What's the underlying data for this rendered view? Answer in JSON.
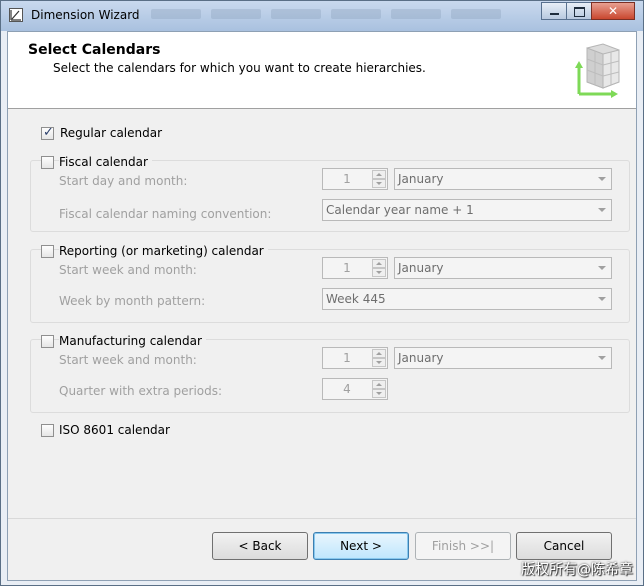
{
  "window": {
    "title": "Dimension Wizard"
  },
  "header": {
    "title": "Select Calendars",
    "subtitle": "Select the calendars for which you want to create hierarchies."
  },
  "regular": {
    "label": "Regular calendar",
    "checked": true
  },
  "fiscal": {
    "label": "Fiscal calendar",
    "start_label": "Start day and month:",
    "start_value": "1",
    "start_month": "January",
    "naming_label": "Fiscal calendar naming convention:",
    "naming_value": "Calendar year name + 1"
  },
  "reporting": {
    "label": "Reporting (or marketing) calendar",
    "start_label": "Start week and month:",
    "start_value": "1",
    "start_month": "January",
    "pattern_label": "Week by month pattern:",
    "pattern_value": "Week 445"
  },
  "manufacturing": {
    "label": "Manufacturing calendar",
    "start_label": "Start week and month:",
    "start_value": "1",
    "start_month": "January",
    "quarter_label": "Quarter with extra periods:",
    "quarter_value": "4"
  },
  "iso": {
    "label": "ISO 8601 calendar"
  },
  "buttons": {
    "back": "< Back",
    "next": "Next >",
    "finish": "Finish >>|",
    "cancel": "Cancel"
  },
  "watermark": "版权所有@陈希章"
}
